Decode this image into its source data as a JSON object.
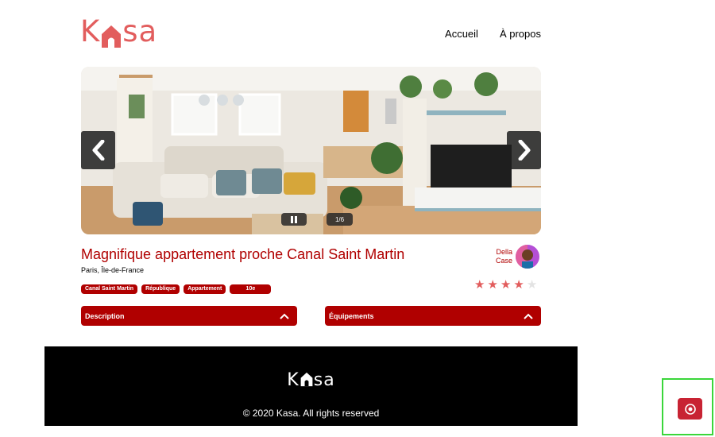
{
  "header": {
    "logo": {
      "left": "K",
      "right": "sa"
    },
    "nav": [
      {
        "label": "Accueil"
      },
      {
        "label": "À propos"
      }
    ]
  },
  "carousel": {
    "counter": "1/6",
    "prev_icon": "chevron-left-icon",
    "next_icon": "chevron-right-icon",
    "pause_icon": "pause-icon"
  },
  "listing": {
    "title": "Magnifique appartement proche Canal Saint Martin",
    "location": "Paris, Île-de-France",
    "tags": [
      "Canal Saint Martin",
      "République",
      "Appartement",
      "10e"
    ],
    "host": {
      "first": "Della",
      "last": "Case"
    },
    "rating": 4,
    "rating_max": 5
  },
  "collapses": {
    "description": "Description",
    "equipments": "Équipements"
  },
  "footer": {
    "logo": {
      "left": "K",
      "right": "sa"
    },
    "copyright": "© 2020 Kasa. All rights reserved"
  },
  "colors": {
    "brand": "#ff6060",
    "primary": "#b00000",
    "star_on": "#e25d5d",
    "star_off": "#e3e3e3",
    "widget": "#c82333"
  },
  "widget": {
    "icon": "eye-icon"
  }
}
